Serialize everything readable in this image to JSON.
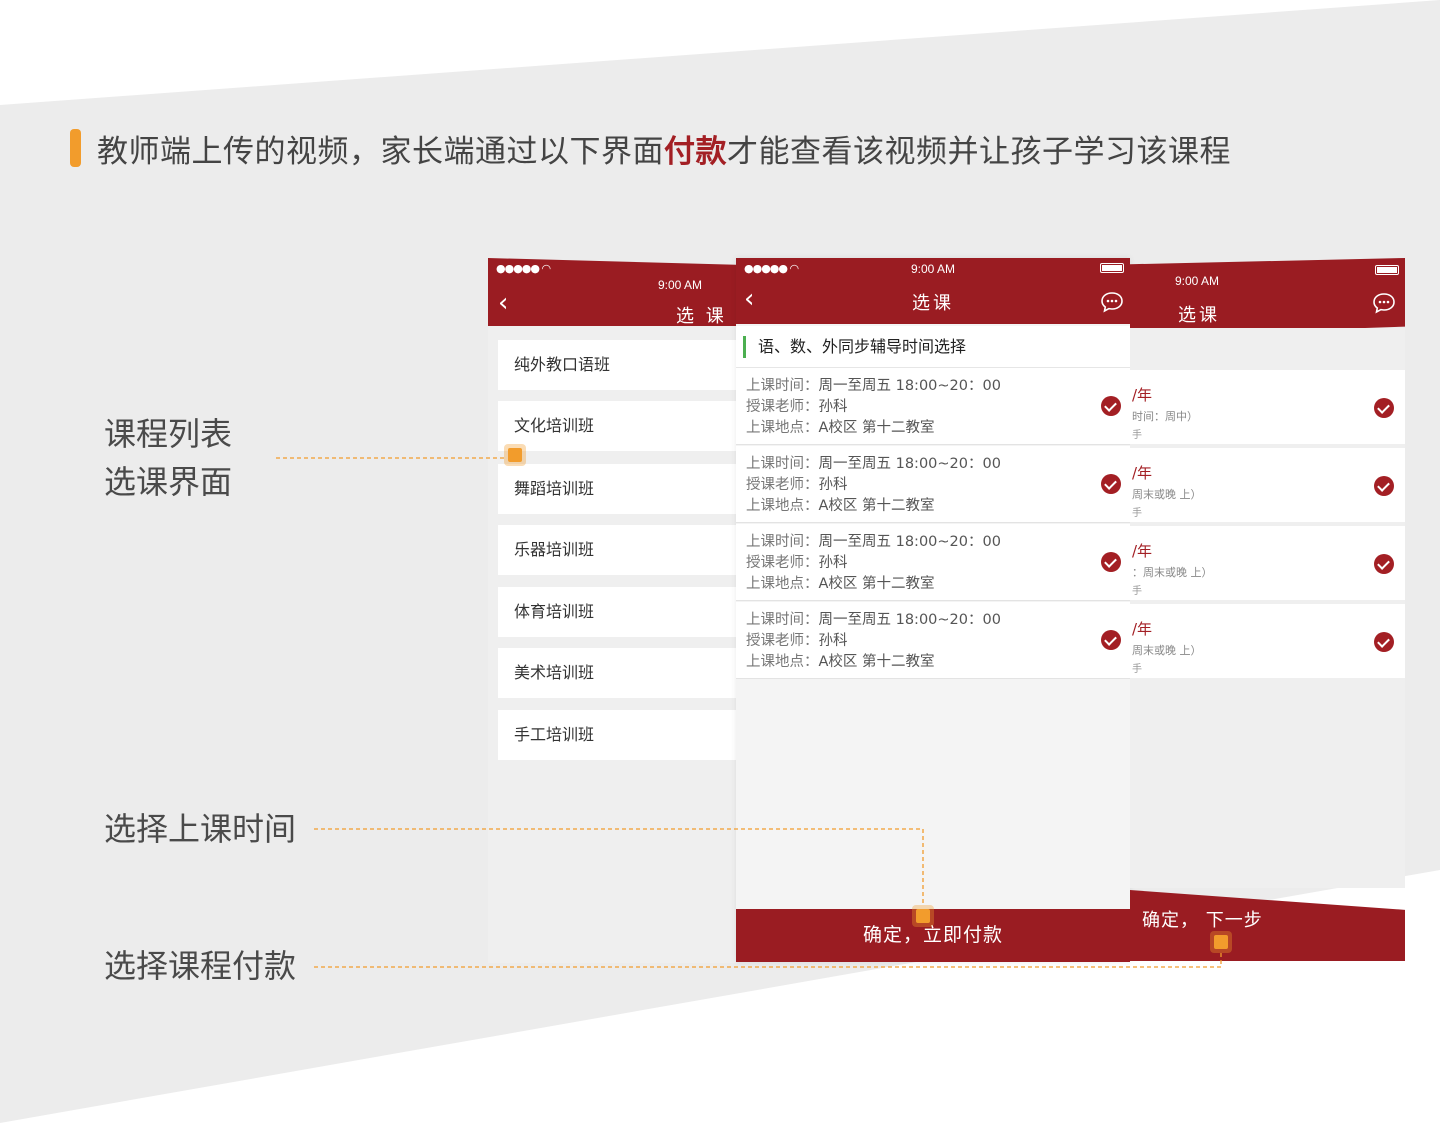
{
  "heading": {
    "prefix": "教师端上传的视频，家长端通过以下界面",
    "highlight": "付款",
    "suffix": "才能查看该视频并让孩子学习该课程"
  },
  "labels": {
    "course_list_line1": "课程列表",
    "course_list_line2": "选课界面",
    "select_time": "选择上课时间",
    "select_pay": "选择课程付款"
  },
  "phone_left": {
    "time": "9:00 AM",
    "title": "选 课",
    "courses": [
      "纯外教口语班",
      "文化培训班",
      "舞蹈培训班",
      "乐器培训班",
      "体育培训班",
      "美术培训班",
      "手工培训班"
    ]
  },
  "phone_mid": {
    "time": "9:00 AM",
    "title": "选课",
    "section_title": "语、数、外同步辅导时间选择",
    "slots": [
      {
        "time_label": "上课时间：",
        "time": "周一至周五 18:00~20：00",
        "teacher_label": "授课老师：",
        "teacher": "孙科",
        "place_label": "上课地点：",
        "place": "A校区 第十二教室"
      },
      {
        "time_label": "上课时间：",
        "time": "周一至周五 18:00~20：00",
        "teacher_label": "授课老师：",
        "teacher": "孙科",
        "place_label": "上课地点：",
        "place": "A校区 第十二教室"
      },
      {
        "time_label": "上课时间：",
        "time": "周一至周五 18:00~20：00",
        "teacher_label": "授课老师：",
        "teacher": "孙科",
        "place_label": "上课地点：",
        "place": "A校区 第十二教室"
      },
      {
        "time_label": "上课时间：",
        "time": "周一至周五 18:00~20：00",
        "teacher_label": "授课老师：",
        "teacher": "孙科",
        "place_label": "上课地点：",
        "place": "A校区 第十二教室"
      }
    ],
    "confirm": "确定，立即付款"
  },
  "phone_right": {
    "time": "9:00 AM",
    "title": "选课",
    "cards": [
      {
        "price": "/年",
        "time": "时间：周中）",
        "sub": "手"
      },
      {
        "price": "/年",
        "time": "周末或晚 上）",
        "sub": "手"
      },
      {
        "price": "/年",
        "time": "：周末或晚 上）",
        "sub": "手"
      },
      {
        "price": "/年",
        "time": "周末或晚 上）",
        "sub": "手"
      }
    ],
    "next": "确定， 下一步"
  },
  "colors": {
    "brand_red": "#9a1c22",
    "accent_orange": "#f29c2c",
    "green_accent": "#4caf50"
  }
}
